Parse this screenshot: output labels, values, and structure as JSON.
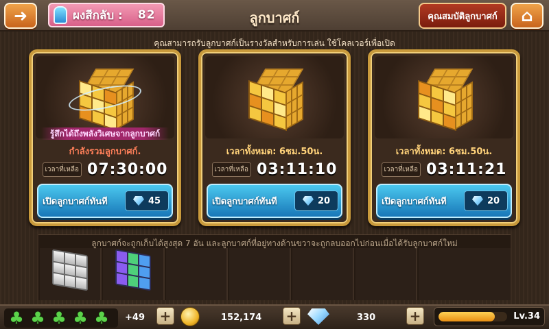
{
  "header": {
    "spirit_label": "ผงสีกลับ :",
    "spirit_value": "82",
    "title": "ลูกบาศก์",
    "properties_button": "คุณสมบัติลูกบาศก์"
  },
  "instruction": "คุณสามารถรับลูกบาศก์เป็นรางวัลสำหรับการเล่น ใช้โคลเวอร์เพื่อเปิด",
  "cards": [
    {
      "banner": "รู้สึกได้ถึงพลังวิเศษจากลูกบาศก์",
      "label": "กำลังรวมลูกบาศก์.",
      "time_tag": "เวลาที่เหลือ",
      "time_value": "07:30:00",
      "button_label": "เปิดลูกบาศก์ทันที",
      "gem_count": "45"
    },
    {
      "banner": "",
      "label": "เวลาทั้งหมด: 6ชม.50น.",
      "time_tag": "เวลาที่เหลือ",
      "time_value": "03:11:10",
      "button_label": "เปิดลูกบาศก์ทันที",
      "gem_count": "20"
    },
    {
      "banner": "",
      "label": "เวลาทั้งหมด: 6ชม.50น.",
      "time_tag": "เวลาที่เหลือ",
      "time_value": "03:11:21",
      "button_label": "เปิดลูกบาศก์ทันที",
      "gem_count": "20"
    }
  ],
  "inventory": {
    "note": "ลูกบาศก์จะถูกเก็บได้สูงสุด 7 อัน และลูกบาศก์ที่อยู่ทางด้านขวาจะถูกลบออกไปก่อนเมื่อได้รับลูกบาศก์ใหม่",
    "slots": [
      "silver-cube",
      "jewel-cube",
      "",
      "",
      "",
      "",
      ""
    ]
  },
  "footer": {
    "clover_extra": "+49",
    "coins": "152,174",
    "gems": "330",
    "level": "Lv.34",
    "level_progress": 0.82
  },
  "colors": {
    "card_border": "#c99a3c",
    "button_blue": "#1877b8",
    "title_pink": "#d86089"
  }
}
